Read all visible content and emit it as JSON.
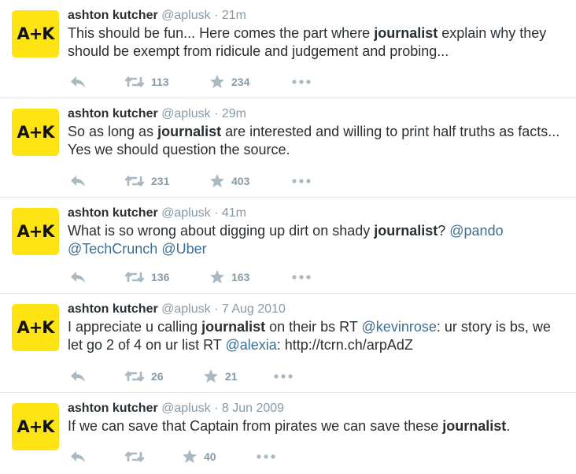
{
  "colors": {
    "accent": "#3b6f96",
    "muted": "#8899a6",
    "avatar_bg": "#ffe414"
  },
  "icons": [
    "reply-icon",
    "retweet-icon",
    "favorite-star-icon",
    "more-dots-icon"
  ],
  "tweets": [
    {
      "avatar_text": "A+K",
      "name": "ashton kutcher",
      "handle": "@aplusk",
      "sep": "·",
      "time": "21m",
      "text": {
        "p1": "This should be fun... Here comes the part where ",
        "k1": "journalist",
        "p2": " explain why they should be exempt from ridicule and judgement and probing..."
      },
      "retweets": "113",
      "favorites": "234"
    },
    {
      "avatar_text": "A+K",
      "name": "ashton kutcher",
      "handle": "@aplusk",
      "sep": "·",
      "time": "29m",
      "text": {
        "p1": "So as long as ",
        "k1": "journalist",
        "p2": " are interested and willing to print half truths as facts... Yes we should question the source."
      },
      "retweets": "231",
      "favorites": "403"
    },
    {
      "avatar_text": "A+K",
      "name": "ashton kutcher",
      "handle": "@aplusk",
      "sep": "·",
      "time": "41m",
      "text": {
        "p1": "What is so wrong about digging up dirt on shady ",
        "k1": "journalist",
        "p2": "? ",
        "m1": "@pando",
        "p3": " ",
        "m2": "@TechCrunch",
        "p4": " ",
        "m3": "@Uber"
      },
      "retweets": "136",
      "favorites": "163"
    },
    {
      "avatar_text": "A+K",
      "name": "ashton kutcher",
      "handle": "@aplusk",
      "sep": "·",
      "time": "7 Aug 2010",
      "text": {
        "p1": "I appreciate u calling ",
        "k1": "journalist",
        "p2": " on their bs RT ",
        "m1": "@kevinrose",
        "p3": ": ur story is bs, we let go 2 of 4 on ur list RT ",
        "m2": "@alexia",
        "p4": ": http://tcrn.ch/arpAdZ"
      },
      "retweets": "26",
      "favorites": "21"
    },
    {
      "avatar_text": "A+K",
      "name": "ashton kutcher",
      "handle": "@aplusk",
      "sep": "·",
      "time": "8 Jun 2009",
      "text": {
        "p1": "If we can save that Captain from pirates we can save these ",
        "k1": "journalist",
        "p2": "."
      },
      "retweets": "",
      "favorites": "40"
    }
  ]
}
